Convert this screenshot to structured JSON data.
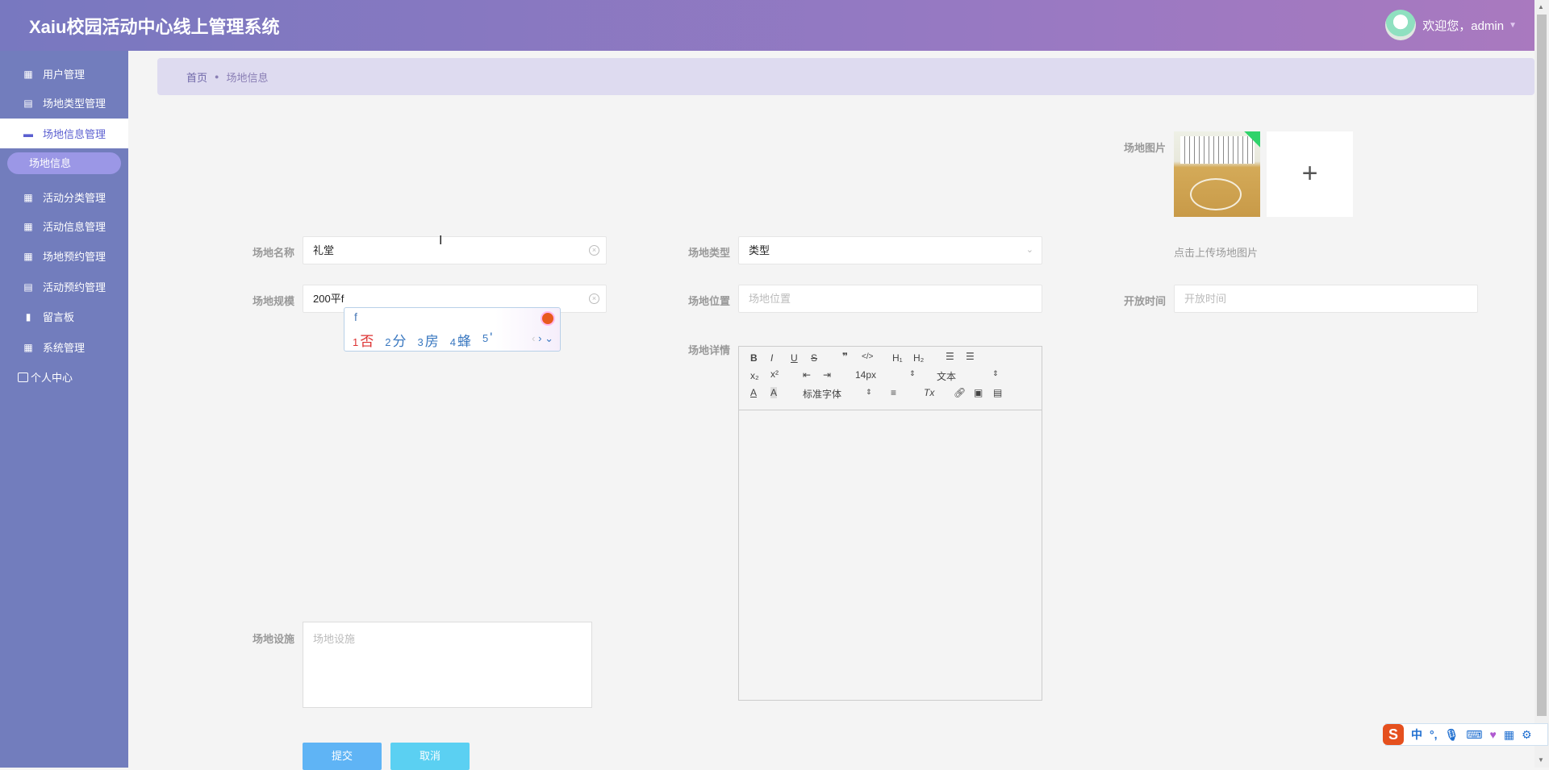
{
  "header": {
    "title": "Xaiu校园活动中心线上管理系统",
    "welcome": "欢迎您，admin"
  },
  "sidebar": {
    "items": [
      {
        "label": "用户管理",
        "icon": "grid-icon"
      },
      {
        "label": "场地类型管理",
        "icon": "clipboard-icon"
      },
      {
        "label": "场地信息管理",
        "icon": "message-icon",
        "active": true
      },
      {
        "label": "活动分类管理",
        "icon": "grid-icon"
      },
      {
        "label": "活动信息管理",
        "icon": "grid-9-icon"
      },
      {
        "label": "场地预约管理",
        "icon": "grid-icon"
      },
      {
        "label": "活动预约管理",
        "icon": "clipboard-x-icon"
      },
      {
        "label": "留言板",
        "icon": "board-icon"
      },
      {
        "label": "系统管理",
        "icon": "grid-icon"
      }
    ],
    "sub_item": "场地信息",
    "personal": "个人中心"
  },
  "breadcrumb": {
    "home": "首页",
    "current": "场地信息"
  },
  "form": {
    "name": {
      "label": "场地名称",
      "value": "礼堂"
    },
    "scale": {
      "label": "场地规模",
      "value": "200平f"
    },
    "type": {
      "label": "场地类型",
      "value": "类型"
    },
    "location": {
      "label": "场地位置",
      "placeholder": "场地位置"
    },
    "details": {
      "label": "场地详情"
    },
    "image": {
      "label": "场地图片",
      "hint": "点击上传场地图片"
    },
    "open_time": {
      "label": "开放时间",
      "placeholder": "开放时间"
    },
    "facilities": {
      "label": "场地设施",
      "placeholder": "场地设施"
    },
    "submit": "提交",
    "cancel": "取消"
  },
  "editor": {
    "font_size": "14px",
    "paragraph": "文本",
    "font_family": "标准字体"
  },
  "ime": {
    "pinyin": "f",
    "candidates": [
      {
        "n": "1",
        "c": "否"
      },
      {
        "n": "2",
        "c": "分"
      },
      {
        "n": "3",
        "c": "房"
      },
      {
        "n": "4",
        "c": "蜂"
      },
      {
        "n": "5",
        "c": "'"
      }
    ]
  },
  "imebar": {
    "mode": "中",
    "punct": "°,"
  },
  "colors": {
    "accent": "#5b5fd0",
    "sidebar": "#727dbd",
    "submit": "#5fb4f5",
    "cancel": "#5bd0f2"
  }
}
